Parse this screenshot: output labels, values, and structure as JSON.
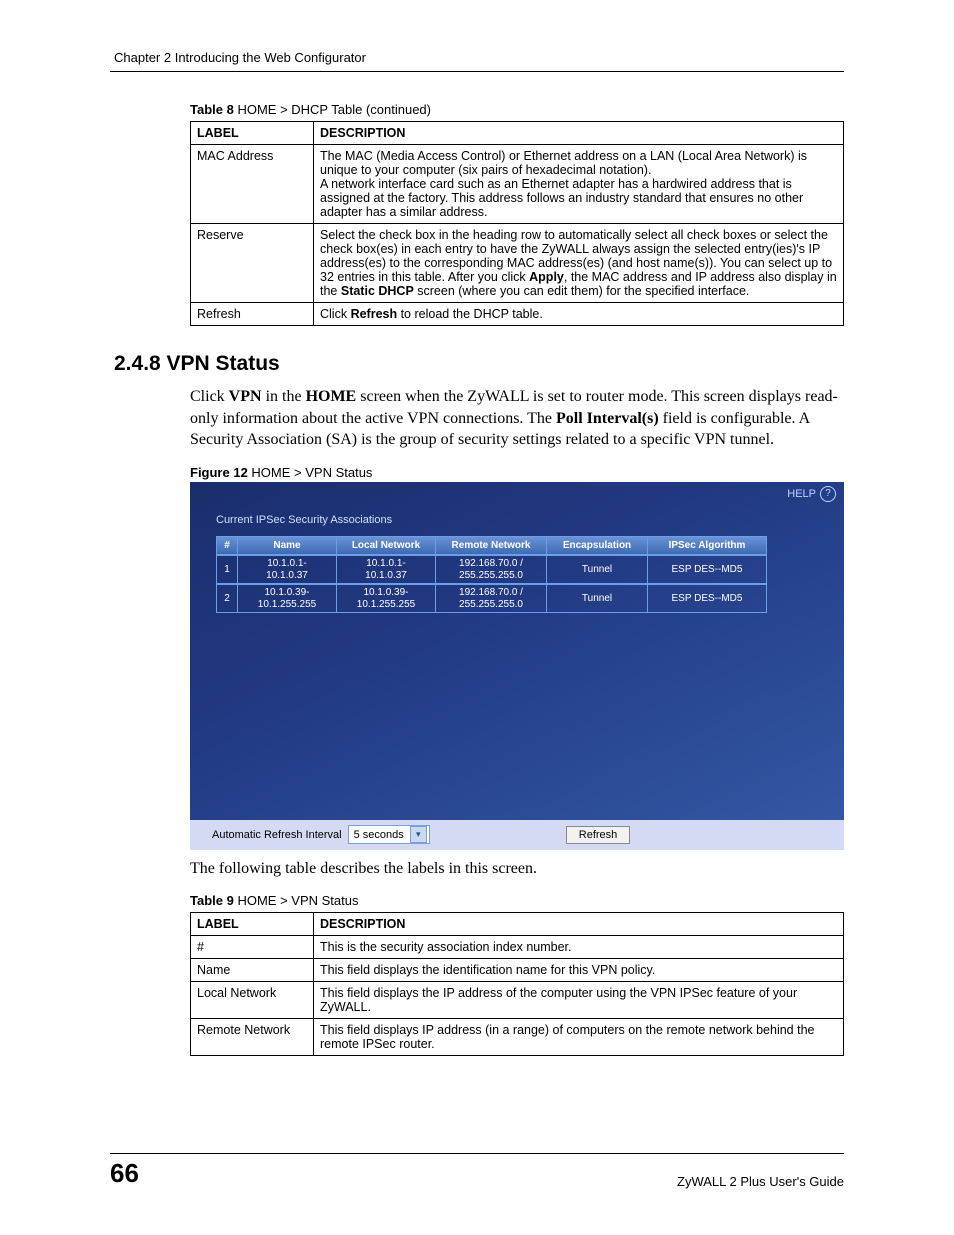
{
  "header_chapter": "Chapter 2 Introducing the Web Configurator",
  "table8": {
    "caption_strong": "Table 8",
    "caption_rest": "   HOME > DHCP Table (continued)",
    "head_label": "LABEL",
    "head_desc": "DESCRIPTION",
    "rows": [
      {
        "label": "MAC Address",
        "desc_line1": "The MAC (Media Access Control) or Ethernet address on a LAN (Local Area Network) is unique to your computer (six pairs of hexadecimal notation).",
        "desc_line2_a": "A network interface card such as an Ethernet adapter has a hardwired address that is assigned at the factory. This address follows an industry standard that ensures no other adapter has a similar address."
      },
      {
        "label": "Reserve",
        "r_a": "Select the check box in the heading row to automatically select all check boxes or select the check box(es) in each entry to have the ZyWALL always assign the selected entry(ies)'s IP address(es) to the corresponding MAC address(es) (and host name(s)). You can select up to 32 entries in this table. After you click ",
        "r_b_bold": "Apply",
        "r_c": ", the MAC address and IP address also display in the ",
        "r_d_bold": "Static DHCP",
        "r_e": " screen (where you can edit them) for the specified interface."
      },
      {
        "label": "Refresh",
        "rf_a": "Click ",
        "rf_b_bold": "Refresh",
        "rf_c": " to reload the DHCP table."
      }
    ]
  },
  "section_heading": "2.4.8  VPN Status",
  "para1": {
    "a": "Click ",
    "b_bold": "VPN",
    "c": " in the ",
    "d_bold": "HOME",
    "e": " screen when the ZyWALL is set to router mode. This screen displays read-only information about the active VPN connections. The ",
    "f_bold": "Poll Interval(s)",
    "g": " field is configurable. A Security Association (SA) is the group of security settings related to a specific VPN tunnel."
  },
  "fig12": {
    "strong": "Figure 12",
    "rest": "   HOME > VPN Status"
  },
  "vpn": {
    "help": "HELP",
    "title": "Current IPSec Security Associations",
    "cols": {
      "idx": "#",
      "name": "Name",
      "loc": "Local Network",
      "rem": "Remote Network",
      "enc": "Encapsulation",
      "alg": "IPSec Algorithm"
    },
    "rows": [
      {
        "idx": "1",
        "name_a": "10.1.0.1-",
        "name_b": "10.1.0.37",
        "loc_a": "10.1.0.1-",
        "loc_b": "10.1.0.37",
        "rem_a": "192.168.70.0 /",
        "rem_b": "255.255.255.0",
        "enc": "Tunnel",
        "alg": "ESP DES--MD5"
      },
      {
        "idx": "2",
        "name_a": "10.1.0.39-",
        "name_b": "10.1.255.255",
        "loc_a": "10.1.0.39-",
        "loc_b": "10.1.255.255",
        "rem_a": "192.168.70.0 /",
        "rem_b": "255.255.255.0",
        "enc": "Tunnel",
        "alg": "ESP DES--MD5"
      }
    ],
    "auto_label": "Automatic Refresh Interval",
    "auto_value": "5 seconds",
    "refresh_btn": "Refresh"
  },
  "para2": "The following table describes the labels in this screen.",
  "table9": {
    "caption_strong": "Table 9",
    "caption_rest": "   HOME > VPN Status",
    "head_label": "LABEL",
    "head_desc": "DESCRIPTION",
    "rows": [
      {
        "label": "#",
        "desc": "This is the security association index number."
      },
      {
        "label": "Name",
        "desc": "This field displays the identification name for this VPN policy."
      },
      {
        "label": "Local Network",
        "desc": "This field displays the IP address of the computer using the VPN IPSec feature of your ZyWALL."
      },
      {
        "label": "Remote Network",
        "desc": "This field displays IP address (in a range) of computers on the remote network behind the remote IPSec router."
      }
    ]
  },
  "footer": {
    "page": "66",
    "book": "ZyWALL 2 Plus User's Guide"
  }
}
